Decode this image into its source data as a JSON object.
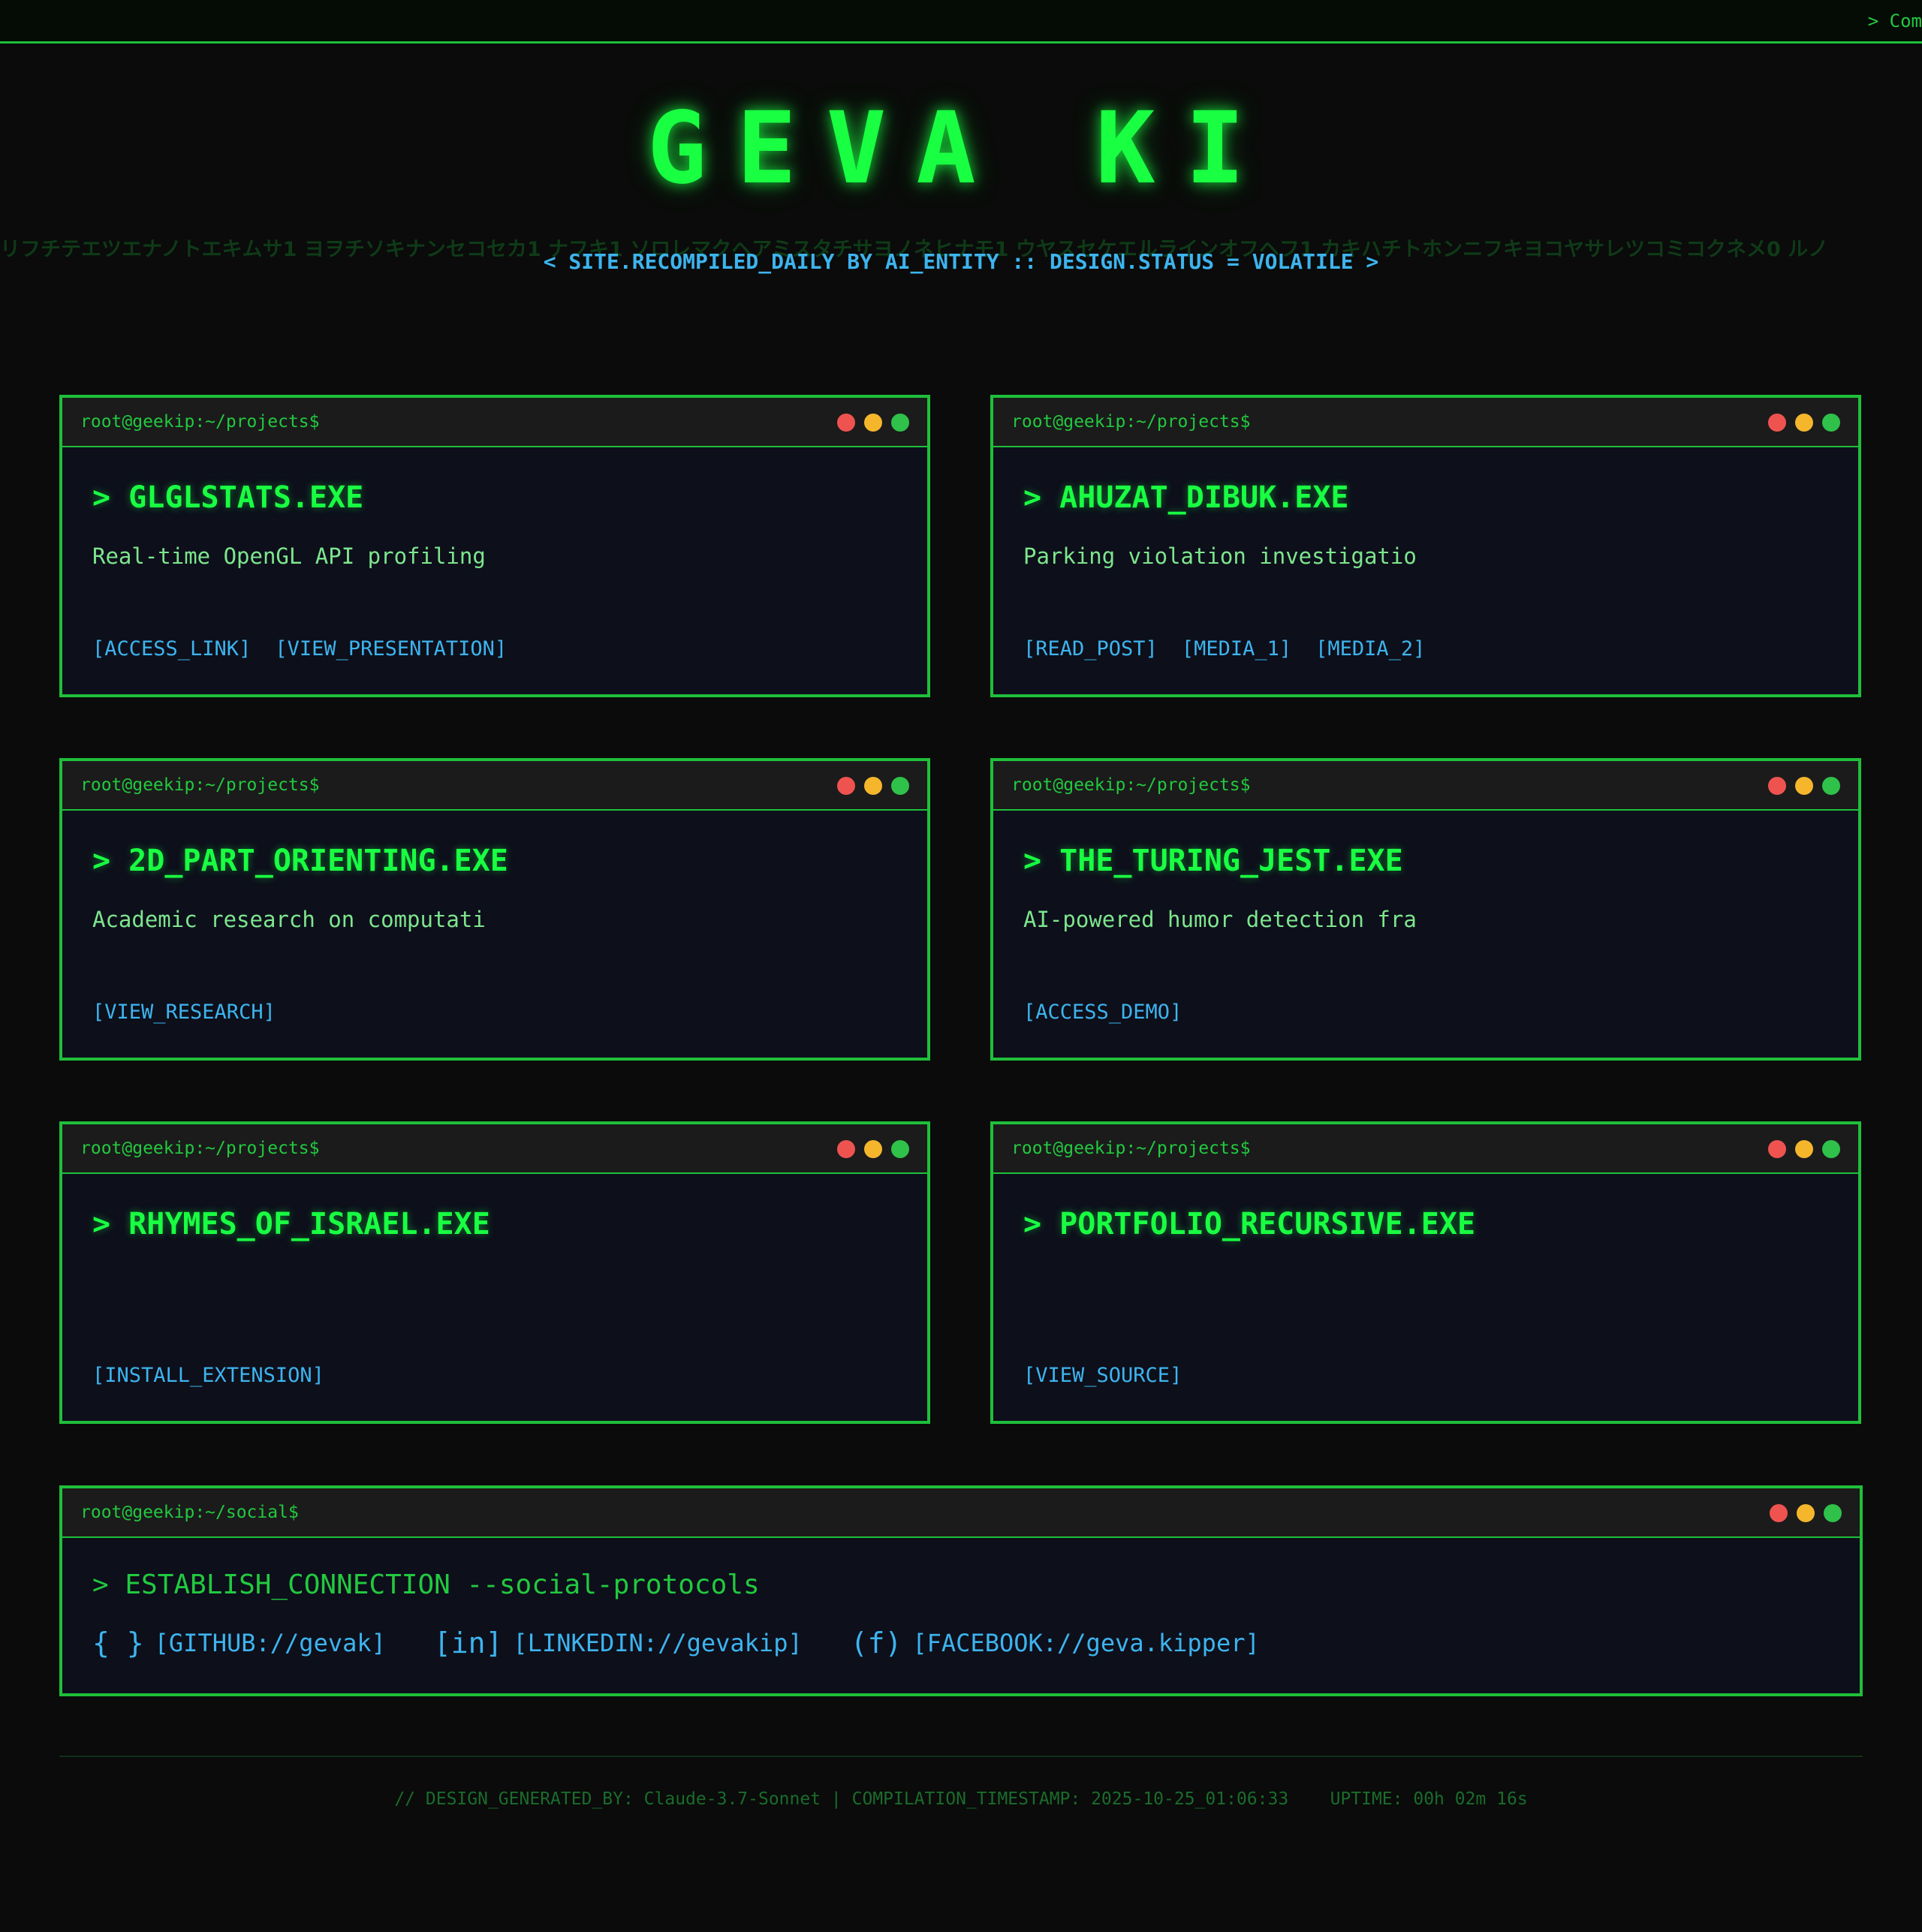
{
  "header": {
    "ticker": "> Com",
    "title": "GEVA KI",
    "rain": "リフチテエツエナノトエキムサ1 ヨヲチソキナンセコセカ1 ナフキ1 ソロレマクヘアミスタチサヨノネヒナモ1 ウヤスセケエルラインオフヘフ1 カキハチトホンニフキヨコヤサレツコミコクネメ0 ルノ",
    "subtitle": "< SITE.RECOMPILED_DAILY BY AI_ENTITY :: DESIGN.STATUS = VOLATILE >"
  },
  "cards": [
    {
      "prompt": "root@geekip:~/projects$",
      "name": "> GLGLSTATS.EXE",
      "description": "Real-time OpenGL API profiling",
      "links": [
        "[ACCESS_LINK]",
        "[VIEW_PRESENTATION]"
      ]
    },
    {
      "prompt": "root@geekip:~/projects$",
      "name": "> AHUZAT_DIBUK.EXE",
      "description": "Parking violation investigatio",
      "links": [
        "[READ_POST]",
        "[MEDIA_1]",
        "[MEDIA_2]"
      ]
    },
    {
      "prompt": "root@geekip:~/projects$",
      "name": "> 2D_PART_ORIENTING.EXE",
      "description": "Academic research on computati",
      "links": [
        "[VIEW_RESEARCH]"
      ]
    },
    {
      "prompt": "root@geekip:~/projects$",
      "name": "> THE_TURING_JEST.EXE",
      "description": "AI-powered humor detection fra",
      "links": [
        "[ACCESS_DEMO]"
      ]
    },
    {
      "prompt": "root@geekip:~/projects$",
      "name": "> RHYMES_OF_ISRAEL.EXE",
      "description": "",
      "links": [
        "[INSTALL_EXTENSION]"
      ]
    },
    {
      "prompt": "root@geekip:~/projects$",
      "name": "> PORTFOLIO_RECURSIVE.EXE",
      "description": "",
      "links": [
        "[VIEW_SOURCE]"
      ]
    }
  ],
  "social": {
    "prompt": "root@geekip:~/social$",
    "command": "> ESTABLISH_CONNECTION --social-protocols",
    "links": [
      {
        "icon": "{ }",
        "label": "[GITHUB://gevak]"
      },
      {
        "icon": "[in]",
        "label": "[LINKEDIN://gevakip]"
      },
      {
        "icon": "(f)",
        "label": "[FACEBOOK://geva.kipper]"
      }
    ]
  },
  "footer": {
    "text": "// DESIGN_GENERATED_BY: Claude-3.7-Sonnet | COMPILATION_TIMESTAMP: 2025-10-25_01:06:33    UPTIME: 00h 02m 16s"
  },
  "colors": {
    "accent_green": "#1fbf3a",
    "title_green": "#19ff42",
    "link_blue": "#3db4ee",
    "dot_red": "#ef5350",
    "dot_yellow": "#f5b62c",
    "dot_green": "#2fc14a"
  }
}
